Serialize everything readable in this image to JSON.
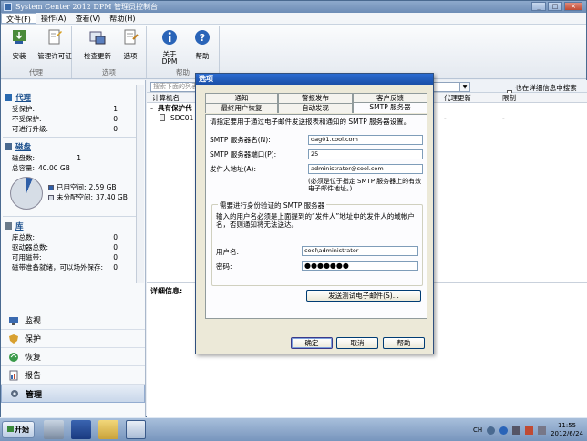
{
  "window": {
    "title": "System Center 2012 DPM 管理员控制台"
  },
  "menu": [
    "文件(F)",
    "操作(A)",
    "查看(V)",
    "帮助(H)"
  ],
  "ribbon": {
    "groups": [
      {
        "label": "代理",
        "buttons": [
          "安装",
          "管理许可证"
        ]
      },
      {
        "label": "选项",
        "buttons": [
          "检查更新",
          "选项"
        ]
      },
      {
        "label": "帮助",
        "buttons": [
          "关于\nDPM",
          "帮助"
        ]
      }
    ]
  },
  "leftnav": {
    "agents": {
      "title": "代理",
      "rows": [
        [
          "受保护:",
          "1"
        ],
        [
          "不受保护:",
          "0"
        ],
        [
          "可进行升级:",
          "0"
        ]
      ]
    },
    "disks": {
      "title": "磁盘",
      "rows": [
        [
          "磁盘数:",
          "1"
        ],
        [
          "总容量:",
          "40.00 GB"
        ]
      ],
      "legend": [
        {
          "label": "已用空间:",
          "value": "2.59 GB",
          "color": "#2f5fa8"
        },
        {
          "label": "未分配空间:",
          "value": "37.40 GB",
          "color": "#d6dde6"
        }
      ]
    },
    "library": {
      "title": "库",
      "rows": [
        [
          "库总数:",
          "0"
        ],
        [
          "驱动器总数:",
          "0"
        ],
        [
          "可用磁带:",
          "0"
        ],
        [
          "磁带准备就绪，可以场外保存:",
          "0"
        ]
      ]
    },
    "wunderbar": [
      "监视",
      "保护",
      "恢复",
      "报告",
      "管理"
    ],
    "selected_wunderbar": "管理"
  },
  "content": {
    "search_placeholder": "搜索下面的列表",
    "search_details_label": "也在详细信息中搜索(慢)(S)",
    "columns": [
      "计算机名",
      "代理更新",
      "限制"
    ],
    "group_label": "具有保护代",
    "row": {
      "name": "SDC01",
      "update": "-",
      "limit": "-"
    },
    "details_label": "详细信息:"
  },
  "dialog": {
    "title": "选项",
    "tabs_row1": [
      "通知",
      "警报发布",
      "客户反馈"
    ],
    "tabs_row2": [
      "最终用户恢复",
      "自动发现",
      "SMTP 服务器"
    ],
    "active_tab": "SMTP 服务器",
    "description": "请指定要用于通过电子邮件发送报表和通知的 SMTP 服务器设置。",
    "server_name_label": "SMTP 服务器名(N):",
    "server_name_value": "dag01.cool.com",
    "port_label": "SMTP 服务器端口(P):",
    "port_value": "25",
    "from_label": "发件人地址(A):",
    "from_value": "administrator@cool.com",
    "from_hint": "(必须是位于指定 SMTP 服务器上的有效电子邮件地址。)",
    "auth_group_caption": "需要进行身份验证的 SMTP 服务器",
    "auth_desc": "输入的用户名必须是上面提到的“发件人”地址中的发件人的域帐户名，否则通知将无法送达。",
    "user_label": "用户名:",
    "user_value": "cool\\administrator",
    "password_label": "密码:",
    "password_value": "●●●●●●●",
    "test_button": "发送测试电子邮件(S)...",
    "ok": "确定",
    "cancel": "取消",
    "help": "帮助"
  },
  "taskbar": {
    "start": "开始",
    "lang": "CH",
    "time": "11:55",
    "date": "2012/6/24"
  }
}
